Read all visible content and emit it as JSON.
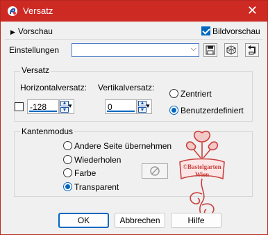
{
  "window": {
    "title": "Versatz"
  },
  "top": {
    "preview_toggle": "Vorschau",
    "bildvorschau": "Bildvorschau",
    "bildvorschau_checked": true
  },
  "settings": {
    "label": "Einstellungen",
    "combo_value": ""
  },
  "versatz": {
    "title": "Versatz",
    "horizontal_label": "Horizontalversatz:",
    "horizontal_value": "-128",
    "vertical_label": "Vertikalversatz:",
    "vertical_value": "0",
    "options": [
      {
        "label": "Zentriert",
        "selected": false
      },
      {
        "label": "Benutzerdefiniert",
        "selected": true
      }
    ]
  },
  "kantenmodus": {
    "title": "Kantenmodus",
    "options": [
      {
        "label": "Andere Seite übernehmen",
        "selected": false
      },
      {
        "label": "Wiederholen",
        "selected": false
      },
      {
        "label": "Farbe",
        "selected": false
      },
      {
        "label": "Transparent",
        "selected": true
      }
    ]
  },
  "watermark": {
    "line1": "©Bastelgarten",
    "line2": "Wien"
  },
  "buttons": {
    "ok": "OK",
    "cancel": "Abbrechen",
    "help": "Hilfe"
  },
  "colors": {
    "titlebar": "#cd2a24",
    "accent": "#0067c0",
    "watermark": "#c9413f"
  }
}
